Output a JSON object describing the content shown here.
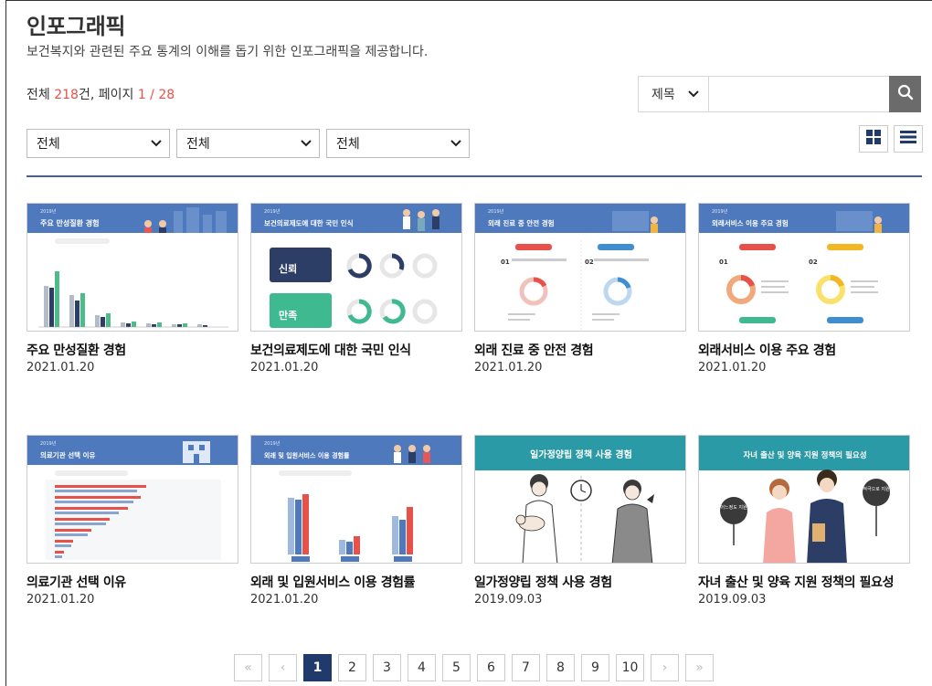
{
  "page": {
    "title": "인포그래픽",
    "subtitle": "보건복지와 관련된 주요 통계의 이해를 돕기 위한 인포그래픽을 제공합니다."
  },
  "summary": {
    "prefix": "전체 ",
    "total": "218",
    "middle": "건, 페이지 ",
    "page": "1 / 28"
  },
  "search": {
    "field_selected": "제목",
    "input_value": "",
    "placeholder": ""
  },
  "filters": [
    "전체",
    "전체",
    "전체"
  ],
  "cards": [
    {
      "title": "주요 만성질환 경험",
      "date": "2021.01.20",
      "thumb_heading": "주요 만성질환 경험",
      "thumb_tag": "2019년"
    },
    {
      "title": "보건의료제도에 대한 국민 인식",
      "date": "2021.01.20",
      "thumb_heading": "보건의료제도에 대한 국민 인식",
      "thumb_tag": "2019년",
      "labels": [
        "신뢰",
        "만족"
      ]
    },
    {
      "title": "외래 진료 중 안전 경험",
      "date": "2021.01.20",
      "thumb_heading": "외래 진료 중 안전 경험",
      "thumb_tag": "2019년",
      "labels": [
        "01",
        "02"
      ]
    },
    {
      "title": "외래서비스 이용 주요 경험",
      "date": "2021.01.20",
      "thumb_heading": "외래서비스 이용 주요 경험",
      "thumb_tag": "2019년",
      "labels": [
        "01",
        "02"
      ]
    },
    {
      "title": "의료기관 선택 이유",
      "date": "2021.01.20",
      "thumb_heading": "의료기관 선택 이유",
      "thumb_tag": "2019년"
    },
    {
      "title": "외래 및 입원서비스 이용 경험률",
      "date": "2021.01.20",
      "thumb_heading": "외래 및 입원서비스 이용 경험률",
      "thumb_tag": "2019년"
    },
    {
      "title": "일가정양립 정책 사용 경험",
      "date": "2019.09.03",
      "thumb_heading": "일가정양립 정책 사용 경험"
    },
    {
      "title": "자녀 출산 및 양육 지원 정책의 필요성",
      "date": "2019.09.03",
      "thumb_heading": "자녀 출산 및 양육 지원 정책의 필요성",
      "labels": [
        "어느정도 지원",
        "적극으로 지원"
      ]
    }
  ],
  "pagination": {
    "first": "«",
    "prev": "‹",
    "pages": [
      "1",
      "2",
      "3",
      "4",
      "5",
      "6",
      "7",
      "8",
      "9",
      "10"
    ],
    "current": "1",
    "next": "›",
    "last": "»"
  },
  "colors": {
    "accent_red": "#e8504a",
    "navy": "#1f3a6b",
    "thumb_blue": "#4e79bd",
    "thumb_teal": "#2a9aa6"
  },
  "icons": {
    "search": "search-icon",
    "grid_view": "grid-view-icon",
    "list_view": "list-view-icon",
    "dropdown": "chevron-down-icon"
  }
}
